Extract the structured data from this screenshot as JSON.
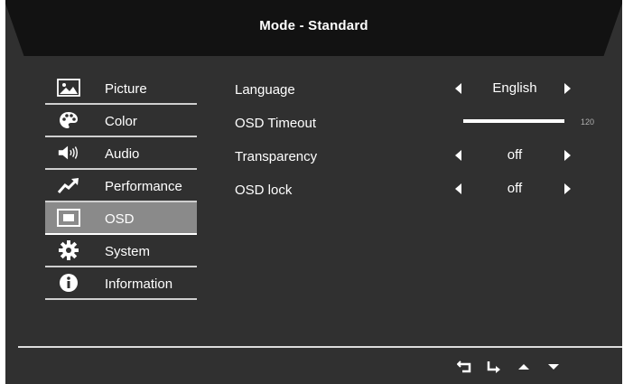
{
  "header": {
    "title": "Mode - Standard"
  },
  "menu": {
    "items": [
      {
        "label": "Picture",
        "icon": "picture-icon"
      },
      {
        "label": "Color",
        "icon": "palette-icon"
      },
      {
        "label": "Audio",
        "icon": "speaker-icon"
      },
      {
        "label": "Performance",
        "icon": "trend-up-icon"
      },
      {
        "label": "OSD",
        "icon": "osd-window-icon",
        "selected": true
      },
      {
        "label": "System",
        "icon": "gear-icon"
      },
      {
        "label": "Information",
        "icon": "info-icon"
      }
    ]
  },
  "settings": {
    "language": {
      "label": "Language",
      "value": "English"
    },
    "osd_timeout": {
      "label": "OSD Timeout",
      "value": "120",
      "max": 120
    },
    "transparency": {
      "label": "Transparency",
      "value": "off"
    },
    "osd_lock": {
      "label": "OSD lock",
      "value": "off"
    }
  },
  "footer": {
    "buttons": [
      "back-icon",
      "enter-icon",
      "up-arrow-icon",
      "down-arrow-icon"
    ]
  },
  "colors": {
    "panel": "#303030",
    "banner": "#121212",
    "selected": "#8a8a8a",
    "text": "#ffffff"
  }
}
